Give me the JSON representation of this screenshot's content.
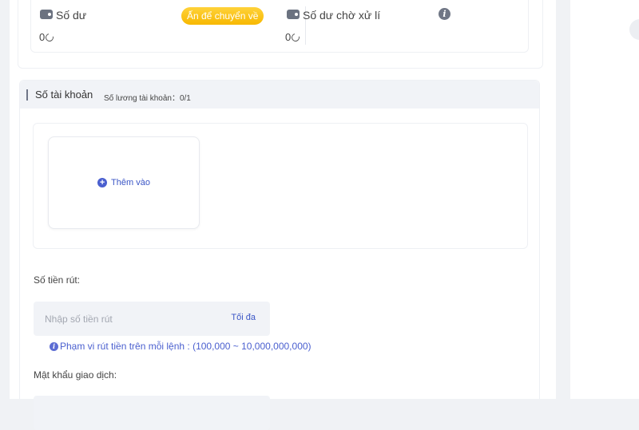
{
  "balance": {
    "label": "Số dư",
    "value": "0",
    "hide_button": "Ấn để chuyển về"
  },
  "pending": {
    "label": "Số dư chờ xử lí",
    "value": "0"
  },
  "accounts": {
    "title": "Số tài khoản",
    "count_label": "Số lương tài khoản：0/1",
    "add_label": "Thêm vào"
  },
  "withdraw": {
    "amount_label": "Số tiền rút:",
    "amount_placeholder": "Nhập số tiền rút",
    "max_label": "Tối đa",
    "range_hint": "Phạm vi rút tiền trên mỗi lệnh : (100,000 ~ 10,000,000,000)",
    "password_label": "Mật khẩu giao dịch:"
  },
  "colors": {
    "accent": "#3b56c6",
    "pill": "#f7b800",
    "panel_bg": "#f1f3f7"
  },
  "icons": [
    "wallet-icon",
    "coin-icon",
    "info-icon",
    "plus-circle-icon"
  ]
}
